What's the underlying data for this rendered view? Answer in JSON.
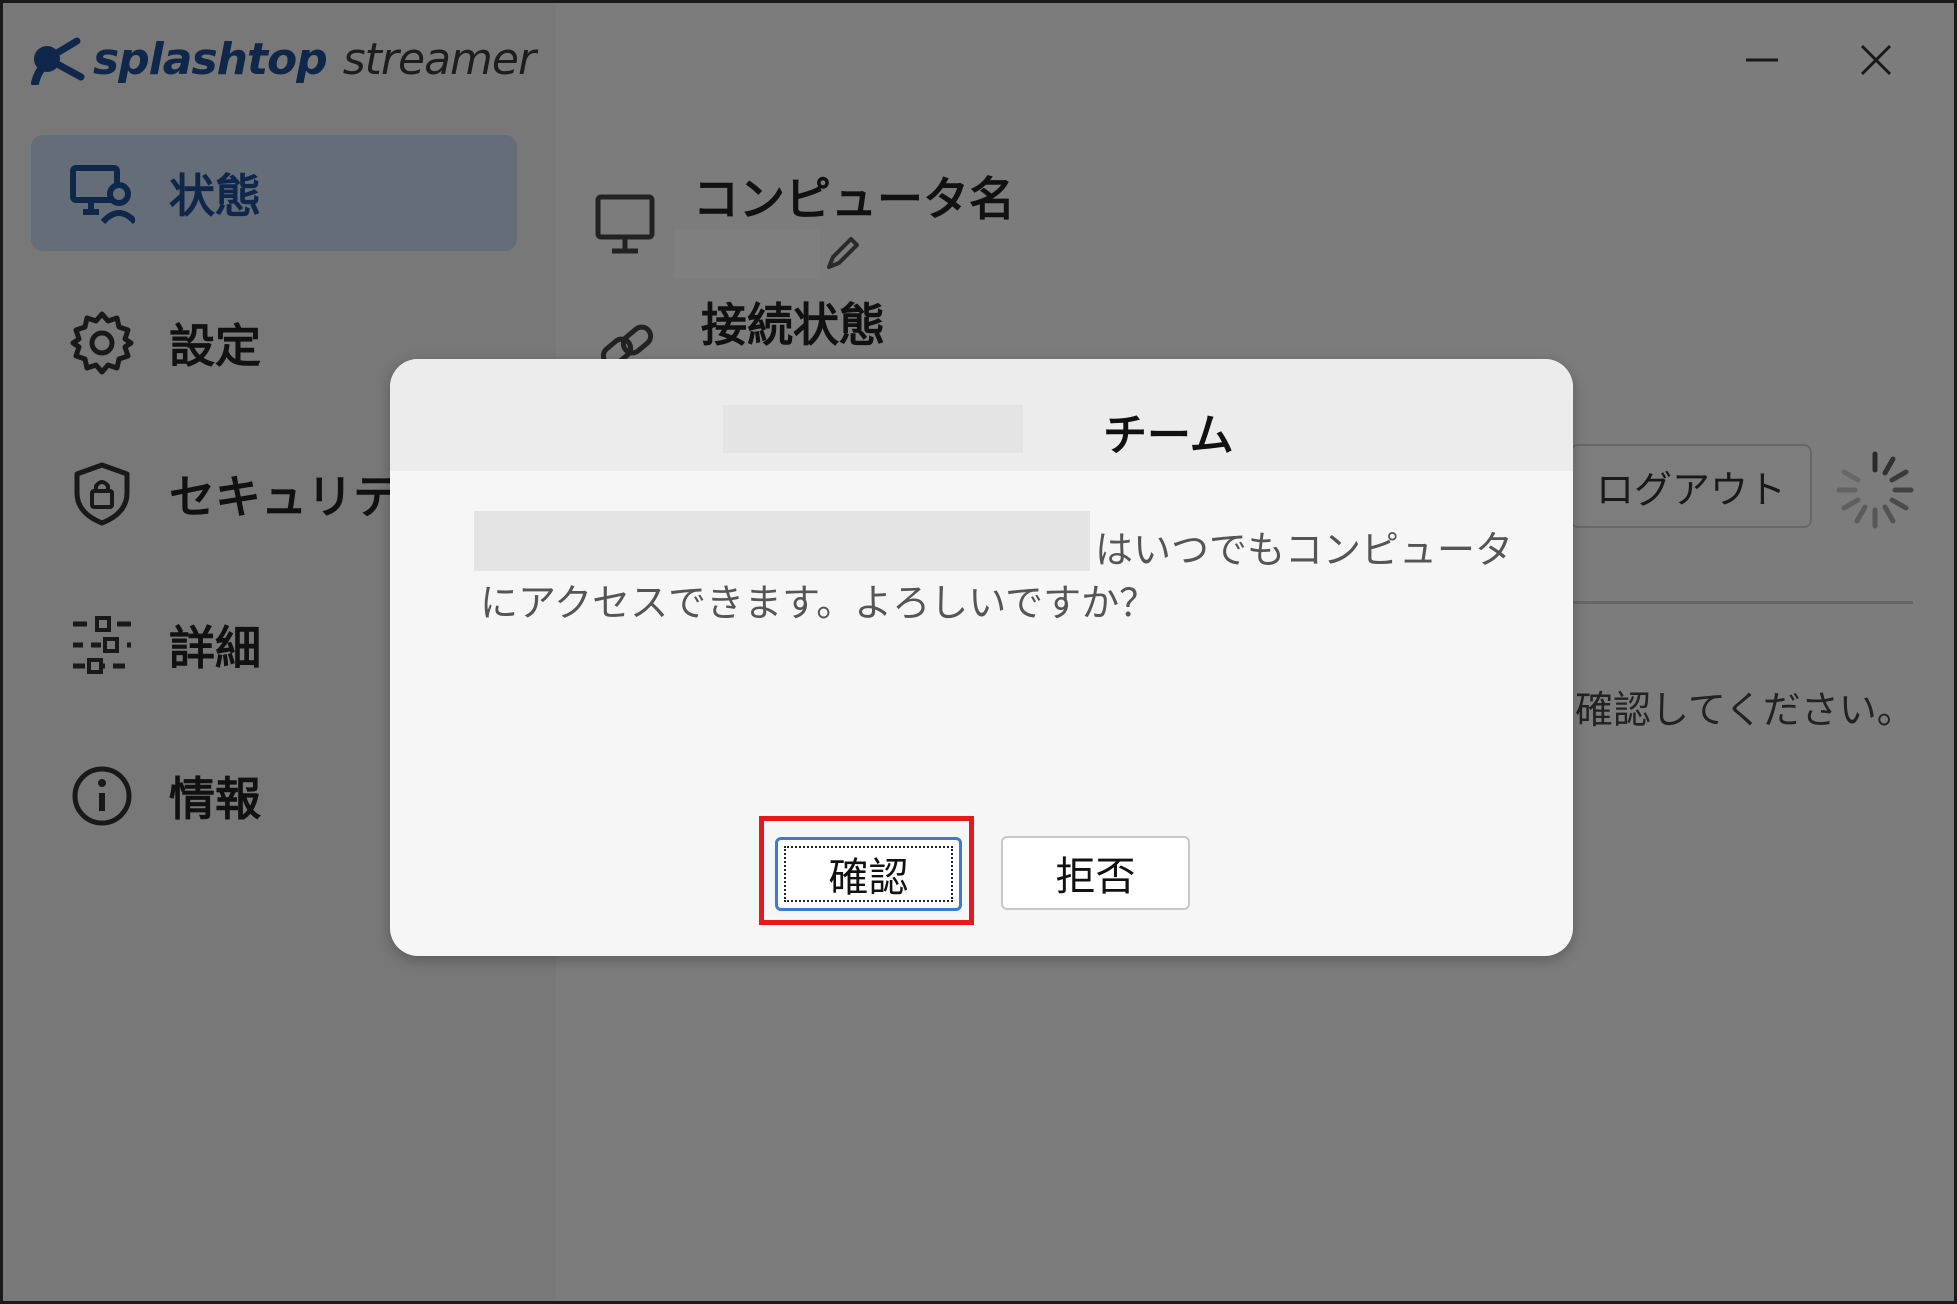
{
  "app": {
    "brand_primary": "splashtop",
    "brand_secondary": "streamer",
    "brand_color": "#1d4f95",
    "icons": {
      "logo": "splashtop-logo-icon",
      "minimize": "minimize-icon",
      "close": "close-icon"
    }
  },
  "sidebar": {
    "active_color": "#c9daf0",
    "items": [
      {
        "label": "状態",
        "icon": "monitor-user-icon",
        "active": true
      },
      {
        "label": "設定",
        "icon": "gear-icon",
        "active": false
      },
      {
        "label": "セキュリティ",
        "icon": "shield-lock-icon",
        "active": false
      },
      {
        "label": "詳細",
        "icon": "sliders-icon",
        "active": false
      },
      {
        "label": "情報",
        "icon": "info-icon",
        "active": false
      }
    ]
  },
  "main": {
    "computer_name": {
      "label": "コンピュータ名",
      "icon": "monitor-icon",
      "edit_icon": "pencil-icon"
    },
    "connection": {
      "label": "接続状態",
      "icon": "link-icon"
    },
    "logout_label": "ログアウト",
    "spinner_icon": "loading-spinner-icon",
    "note_text": "確認してください。"
  },
  "dialog": {
    "title": "チーム",
    "message_line1": "はいつでもコンピュータ",
    "message_line2": "にアクセスできます。よろしいですか？",
    "confirm_label": "確認",
    "reject_label": "拒否"
  },
  "annotation": {
    "highlight_color": "#e5181d"
  }
}
